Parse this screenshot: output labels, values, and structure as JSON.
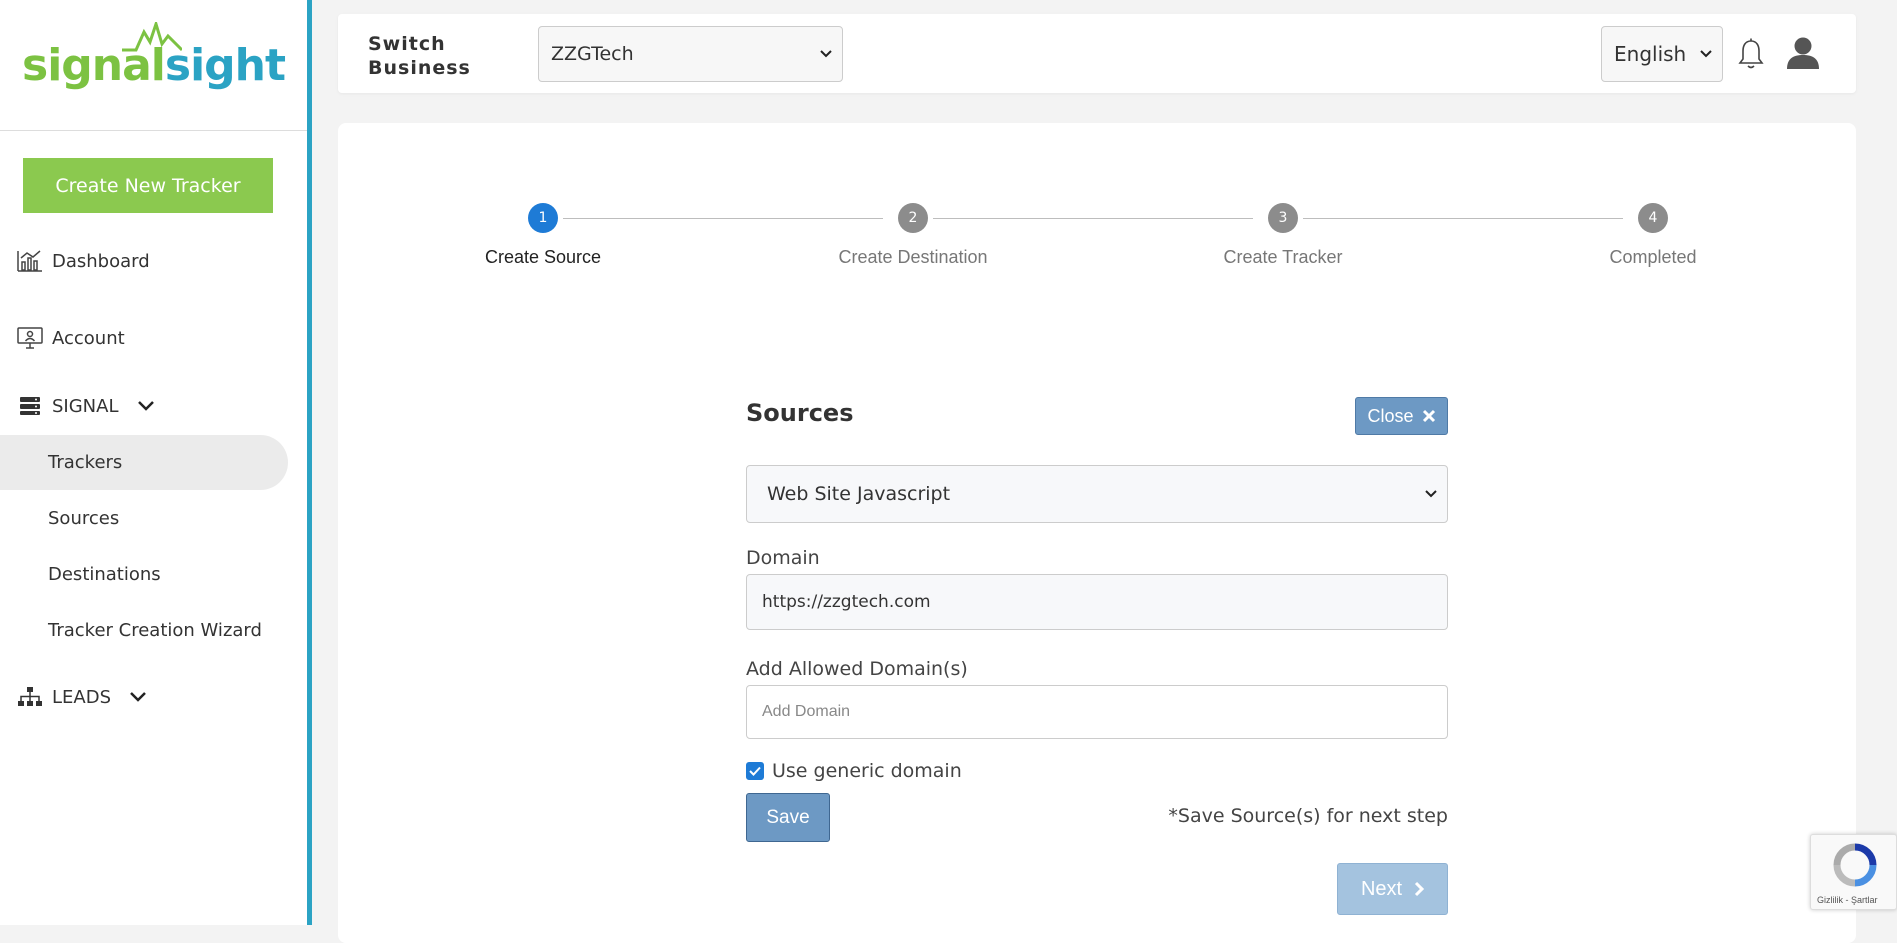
{
  "brand": {
    "logo_part1": "signal",
    "logo_part2": "sight",
    "accent_green": "#8bc94f",
    "accent_blue": "#2ba3c4"
  },
  "sidebar": {
    "create_button": "Create New Tracker",
    "items": [
      {
        "label": "Dashboard",
        "icon": "chart-icon"
      },
      {
        "label": "Account",
        "icon": "monitor-icon"
      }
    ],
    "signal_group": {
      "label": "SIGNAL",
      "icon": "server-icon",
      "children": [
        "Trackers",
        "Sources",
        "Destinations",
        "Tracker Creation Wizard"
      ],
      "active": "Trackers"
    },
    "leads_group": {
      "label": "LEADS",
      "icon": "sitemap-icon"
    }
  },
  "topbar": {
    "switch_label": "Switch Business",
    "business_value": "ZZGTech",
    "language_value": "English"
  },
  "stepper": {
    "steps": [
      {
        "num": "1",
        "label": "Create Source"
      },
      {
        "num": "2",
        "label": "Create Destination"
      },
      {
        "num": "3",
        "label": "Create Tracker"
      },
      {
        "num": "4",
        "label": "Completed"
      }
    ],
    "active_step": 1
  },
  "form": {
    "title": "Sources",
    "close_label": "Close",
    "source_type": "Web Site Javascript",
    "domain_label": "Domain",
    "domain_value": "https://zzgtech.com",
    "allowed_label": "Add Allowed Domain(s)",
    "allowed_placeholder": "Add Domain",
    "generic_label": "Use generic domain",
    "generic_checked": true,
    "save_label": "Save",
    "hint": "*Save Source(s) for next step",
    "next_label": "Next"
  },
  "recaptcha": {
    "text": "Gizlilik - Şartlar"
  }
}
